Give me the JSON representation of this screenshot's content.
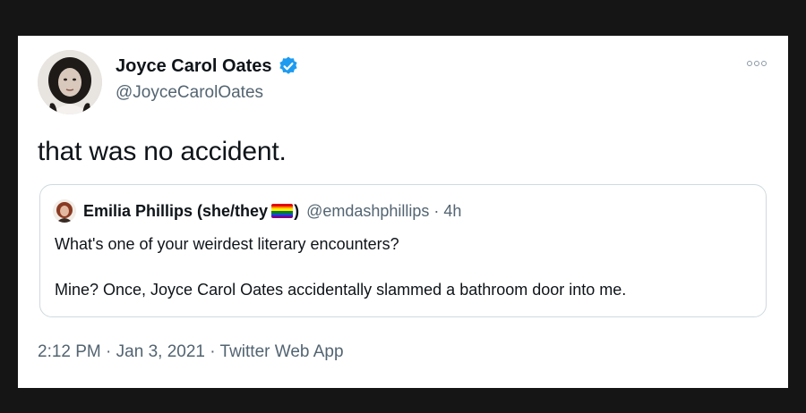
{
  "tweet": {
    "author_name": "Joyce Carol Oates",
    "author_handle": "@JoyceCarolOates",
    "text": "that was no accident.",
    "time": "2:12 PM",
    "date": "Jan 3, 2021",
    "source": "Twitter Web App",
    "separator": " · "
  },
  "quoted": {
    "author_name": "Emilia Phillips (she/they",
    "name_close": ")",
    "author_handle": "@emdashphillips",
    "age": "4h",
    "separator": " · ",
    "line1": "What's one of your weirdest literary encounters?",
    "line2": "Mine? Once, Joyce Carol Oates accidentally slammed a bathroom door into me."
  },
  "colors": {
    "verified_badge": "#1d9bf0",
    "text_primary": "#0f1419",
    "text_secondary": "#536471",
    "quote_border": "#cfd9de",
    "pride_flag": [
      "#e40303",
      "#ff8c00",
      "#ffed00",
      "#008026",
      "#004dff",
      "#750787"
    ]
  },
  "icons": {
    "verified": "verified-badge-icon",
    "more": "more-options-icon",
    "flag": "rainbow-flag-icon"
  }
}
